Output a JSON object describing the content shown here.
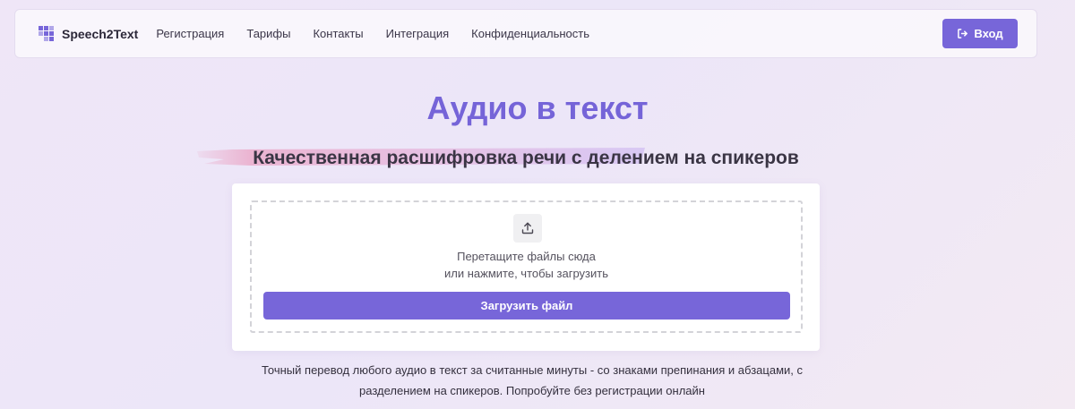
{
  "header": {
    "brand": "Speech2Text",
    "nav": [
      {
        "label": "Регистрация"
      },
      {
        "label": "Тарифы"
      },
      {
        "label": "Контакты"
      },
      {
        "label": "Интеграция"
      },
      {
        "label": "Конфиденциальность"
      }
    ],
    "login_label": "Вход"
  },
  "hero": {
    "title": "Аудио в текст",
    "subtitle": "Качественная расшифровка речи с делением на спикеров"
  },
  "upload": {
    "line1": "Перетащите файлы сюда",
    "line2": "или нажмите, чтобы загрузить",
    "button_label": "Загрузить файл"
  },
  "description": {
    "line1": "Точный перевод любого аудио в текст за считанные минуты - со знаками препинания и абзацами, с",
    "line2": "разделением на спикеров. Попробуйте без регистрации онлайн"
  },
  "colors": {
    "accent": "#7766d9",
    "title": "#7564d8",
    "highlight": "#e9a6c6"
  },
  "icons": {
    "logo": "grid-logo-icon",
    "login": "login-icon",
    "upload": "upload-icon"
  }
}
